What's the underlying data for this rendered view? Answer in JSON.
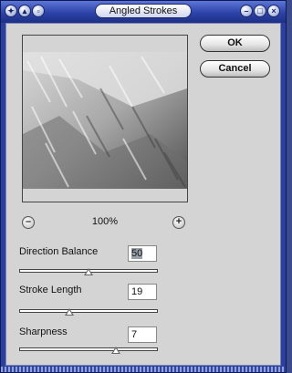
{
  "window": {
    "title": "Angled Strokes",
    "pin_icon": "pin-icon",
    "collapse_icon": "eject-icon",
    "menu_icon": "box-icon",
    "minimize_icon": "minus-icon",
    "maximize_icon": "square-icon",
    "close_icon": "x-icon"
  },
  "buttons": {
    "ok": "OK",
    "cancel": "Cancel"
  },
  "preview": {
    "zoom": "100%",
    "zoom_out_icon": "minus-icon",
    "zoom_in_icon": "plus-icon"
  },
  "params": [
    {
      "label": "Direction Balance",
      "value": "50",
      "selected": true,
      "slider_fraction": 0.5
    },
    {
      "label": "Stroke Length",
      "value": "19",
      "selected": false,
      "slider_fraction": 0.36
    },
    {
      "label": "Sharpness",
      "value": "7",
      "selected": false,
      "slider_fraction": 0.7
    }
  ]
}
